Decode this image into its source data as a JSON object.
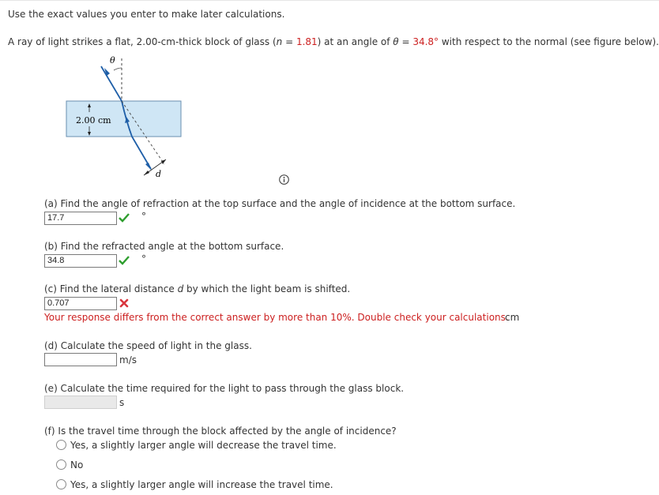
{
  "instructions": "Use the exact values you enter to make later calculations.",
  "problem": {
    "pre": "A ray of light strikes a flat, 2.00-cm-thick block of glass (",
    "n_symbol": "n",
    "eq1": " = ",
    "n_value": "1.81",
    "mid": ") at an angle of ",
    "theta_symbol": "θ",
    "eq2": " = ",
    "theta_value": "34.8°",
    "post": " with respect to the normal (see figure below)."
  },
  "figure": {
    "theta_label": "θ",
    "thickness_label": "2.00 cm",
    "d_label": "d"
  },
  "colors": {
    "accent": "#cc1f1f",
    "correct": "#2e9e2e",
    "glass": "#cfe6f5",
    "ray": "#1f5fa8"
  },
  "parts": {
    "a": {
      "question": "(a) Find the angle of refraction at the top surface and the angle of incidence at the bottom surface.",
      "value": "17.7",
      "unit": "°",
      "status": "correct"
    },
    "b": {
      "question": "(b) Find the refracted angle at the bottom surface.",
      "value": "34.8",
      "unit": "°",
      "status": "correct"
    },
    "c": {
      "question_pre": "(c) Find the lateral distance ",
      "question_var": "d",
      "question_post": " by which the light beam is shifted.",
      "value": "0.707",
      "status": "incorrect",
      "feedback": "Your response differs from the correct answer by more than 10%. Double check your calculations.",
      "unit": "cm"
    },
    "d": {
      "question": "(d) Calculate the speed of light in the glass.",
      "value": "",
      "unit": "m/s"
    },
    "e": {
      "question": "(e) Calculate the time required for the light to pass through the glass block.",
      "value": "",
      "unit": "s"
    },
    "f": {
      "question": "(f) Is the travel time through the block affected by the angle of incidence?",
      "options": [
        "Yes, a slightly larger angle will decrease the travel time.",
        "No",
        "Yes, a slightly larger angle will increase the travel time."
      ]
    }
  }
}
